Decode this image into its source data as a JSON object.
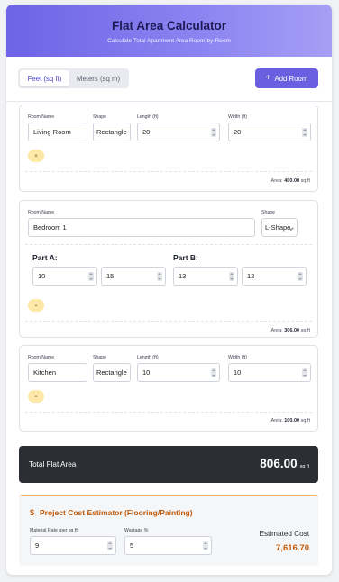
{
  "header": {
    "title": "Flat Area Calculator",
    "subtitle": "Calculate Total Apartment Area Room-by-Room"
  },
  "toolbar": {
    "units": [
      {
        "label": "Feet (sq ft)",
        "active": true
      },
      {
        "label": "Meters (sq m)",
        "active": false
      }
    ],
    "add_room_label": "Add Room"
  },
  "labels": {
    "room_name": "Room Name",
    "shape": "Shape",
    "length": "Length (ft)",
    "width": "Width (ft)",
    "part_a": "Part A:",
    "part_b": "Part B:",
    "area_prefix": "Area:",
    "unit_suffix": "sq ft",
    "remove_symbol": "×"
  },
  "rooms": [
    {
      "name": "Living Room",
      "shape": "Rectangle",
      "length": "20",
      "width": "20",
      "area": "400.00"
    },
    {
      "name": "Bedroom 1",
      "shape": "L-Shape",
      "part_a": {
        "length": "10",
        "width": "15"
      },
      "part_b": {
        "length": "13",
        "width": "12"
      },
      "area": "306.00"
    },
    {
      "name": "Kitchen",
      "shape": "Rectangle",
      "length": "10",
      "width": "10",
      "area": "100.00"
    }
  ],
  "total": {
    "label": "Total Flat Area",
    "value": "806.00",
    "unit": "sq ft"
  },
  "estimator": {
    "title": "Project Cost Estimator (Flooring/Painting)",
    "icon_symbol": "$",
    "rate_label": "Material Rate (per sq ft)",
    "rate_value": "9",
    "wastage_label": "Wastage %",
    "wastage_value": "5",
    "cost_label": "Estimated Cost",
    "cost_value": "7,616.70"
  },
  "colors": {
    "accent": "#6a5fe0",
    "header_gradient_start": "#6c63e6",
    "header_gradient_end": "#a59ff5",
    "total_bg": "#2b2f33",
    "estimator_accent": "#c25a08",
    "remove_button_bg": "#fde8a8"
  },
  "icons": {
    "add": "plus-icon",
    "remove": "close-icon",
    "estimator": "dollar-icon"
  }
}
